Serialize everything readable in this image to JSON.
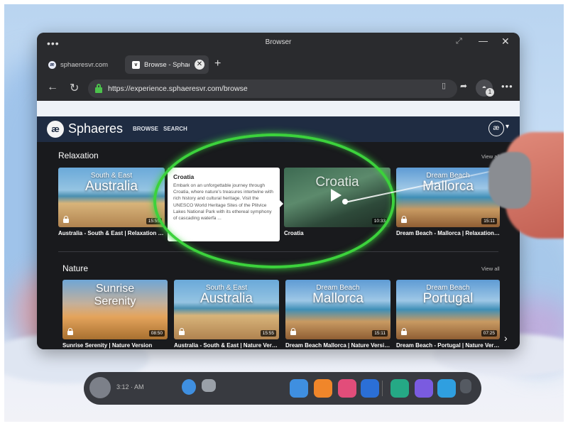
{
  "window": {
    "title": "Browser",
    "menu_icon": "more-horizontal-icon",
    "expand_icon": "expand-icon",
    "minimize_glyph": "—",
    "close_glyph": "✕"
  },
  "tabs": [
    {
      "label": "sphaeresvr.com",
      "icon": "æ",
      "active": false
    },
    {
      "label": "Browse - Sphaeres",
      "icon": "v",
      "active": true
    }
  ],
  "tab_new_label": "+",
  "address_bar": {
    "url": "https://experience.sphaeresvr.com/browse",
    "incognito_count": "1"
  },
  "site": {
    "logo_mark": "æ",
    "logo_text": "Sphaeres",
    "nav": [
      "BROWSE",
      "SEARCH"
    ],
    "account_mark": "æ"
  },
  "sections": [
    {
      "title": "Relaxation",
      "view_all": "View all",
      "cards": [
        {
          "title_small": "South & East",
          "title_big": "Australia",
          "duration": "15:55",
          "caption": "Australia - South & East | Relaxation Version"
        },
        {
          "title_small": "",
          "title_big": "Croatia",
          "duration": "10:33",
          "caption": "Croatia"
        },
        {
          "title_small": "Dream Beach",
          "title_big": "Mallorca",
          "duration": "15:11",
          "caption": "Dream Beach - Mallorca | Relaxation Version"
        }
      ]
    },
    {
      "title": "Nature",
      "view_all": "View all",
      "cards": [
        {
          "title_small": "Sunrise",
          "title_big": "Serenity",
          "duration": "08:50",
          "caption": "Sunrise Serenity | Nature Version"
        },
        {
          "title_small": "South & East",
          "title_big": "Australia",
          "duration": "15:55",
          "caption": "Australia - South & East | Nature Version"
        },
        {
          "title_small": "Dream Beach",
          "title_big": "Mallorca",
          "duration": "15:11",
          "caption": "Dream Beach Mallorca | Nature Version"
        },
        {
          "title_small": "Dream Beach",
          "title_big": "Portugal",
          "duration": "07:25",
          "caption": "Dream Beach - Portugal | Nature Version"
        }
      ]
    }
  ],
  "tooltip": {
    "title": "Croatia",
    "body": "Embark on an unforgettable journey through Croatia, where nature's treasures intertwine with rich history and cultural heritage. Visit the UNESCO World Heritage Sites of the Plitvice Lakes National Park with its ethereal symphony of cascading waterfa ..."
  },
  "taskbar": {
    "time_text": "3:12  ·  AM",
    "icon_colors": [
      "#3f8fe0",
      "#f0862a",
      "#e24d7a",
      "#2b6fd6",
      "#25a985",
      "#7a5be0",
      "#2f9fe0",
      "#555a62"
    ]
  },
  "colors": {
    "highlight": "#3cd23c",
    "header_bg": "#1f2c42"
  }
}
